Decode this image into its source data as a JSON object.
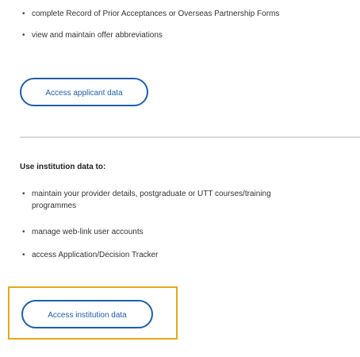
{
  "applicant_bullets": [
    "complete Record of Prior Acceptances or Overseas Partnership Forms",
    "view and maintain offer abbreviations"
  ],
  "applicant_button_label": "Access applicant data",
  "institution": {
    "heading": "Use institution data to:",
    "bullets": [
      "maintain your provider details, postgraduate or UTT courses/training programmes",
      "manage web-link user accounts",
      "access Application/Decision Tracker"
    ],
    "button_label": "Access institution data"
  },
  "colors": {
    "button_border": "#1f5fa8",
    "highlight": "#e8a81a",
    "divider": "#d8d8d8"
  }
}
